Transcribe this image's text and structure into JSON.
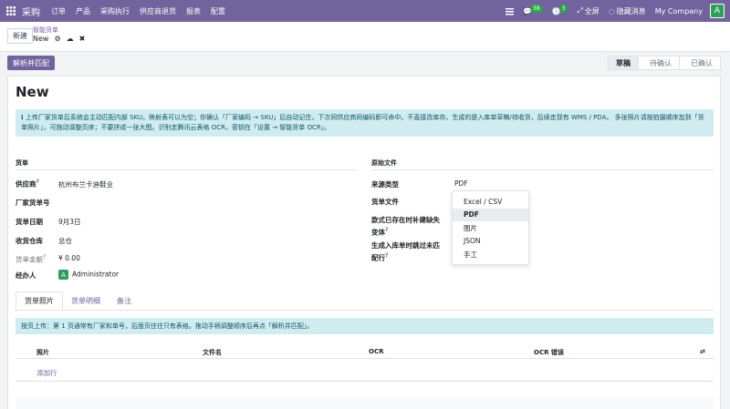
{
  "nav": {
    "brand": "采购",
    "menus": [
      "订单",
      "产品",
      "采购执行",
      "供应商退货",
      "报表",
      "配置"
    ],
    "messages_count": "38",
    "activities_count": "3",
    "fullscreen": "全屏",
    "hide_messages": "隐藏消息",
    "company": "My Company",
    "avatar": "A"
  },
  "control": {
    "new_button": "新建",
    "breadcrumb": "智能货单",
    "record_name": "New"
  },
  "actions": {
    "parse_button": "解析并匹配"
  },
  "statusbar": [
    "草稿",
    "待确认",
    "已确认"
  ],
  "form": {
    "title": "New",
    "alert": "上传厂家货单后系统会主动匹配内部 SKU。映射表可以为空；你确认「厂家编码 → SKU」后自动记住，下次同供应商同编码即可命中。不直接改库存。生成的是入库单草稿/待收货，后续走现有 WMS / PDA。 多张照片请按拍摄顺序加到「货单照片」，可拖动调整页序；不要拼成一张大图。识别走腾讯云表格 OCR，密钥在「设置 → 智能货单 OCR」。",
    "section_left": "货单",
    "section_right": "原始文件",
    "fields_left": [
      {
        "label": "供应商",
        "value": "杭州布兰卡迪鞋业",
        "help": true
      },
      {
        "label": "厂家货单号",
        "value": ""
      },
      {
        "label": "货单日期",
        "value": "9月3日"
      },
      {
        "label": "收货仓库",
        "value": "总仓"
      },
      {
        "label": "货单金额",
        "value": "¥ 0.00",
        "help": true
      },
      {
        "label": "经办人",
        "value": "Administrator",
        "avatar": "A"
      }
    ],
    "fields_right": [
      {
        "label": "来源类型",
        "value": "PDF"
      },
      {
        "label": "货单文件",
        "value": ""
      },
      {
        "label": "款式已存在时补建缺失变体",
        "value": "",
        "help": true
      },
      {
        "label": "生成入库单时跳过未匹配行",
        "value": "",
        "help": true
      }
    ],
    "source_options": [
      "Excel / CSV",
      "PDF",
      "图片",
      "JSON",
      "手工"
    ],
    "source_selected": "PDF"
  },
  "tabs": [
    "货单照片",
    "货单明细",
    "备注"
  ],
  "photos": {
    "hint": "按页上传：第 1 页通常有厂家和单号，后面页往往只有表格。拖动手柄调整顺序后再点「解析并匹配」。",
    "columns": [
      "照片",
      "文件名",
      "OCR",
      "OCR 错误"
    ],
    "add_row": "添加行"
  }
}
